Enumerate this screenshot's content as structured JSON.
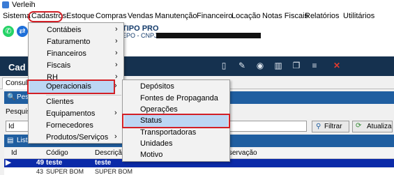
{
  "window": {
    "title": "Verleih"
  },
  "menubar": [
    "Sistema",
    "Cadastros",
    "Estoque",
    "Compras",
    "Vendas",
    "Manutenção",
    "Financeiro",
    "Locação",
    "Notas Fiscais",
    "Relatórios",
    "Utilitários"
  ],
  "company": {
    "name": "TIPO PRO",
    "cnpj_label": "EPO - CNPJ :"
  },
  "section_title": "Cad",
  "tabs": {
    "consulta": "Consulta"
  },
  "panels": {
    "pesquisa_bar": "Pesq",
    "pesquisa_label": "Pesquisa",
    "lista_bar": "Lista"
  },
  "search": {
    "field_label": "Id",
    "filter_button": "Filtrar",
    "refresh_button": "Atualiza"
  },
  "grid": {
    "headers": [
      "Id",
      "Código",
      "Descrição",
      "servação"
    ],
    "rows": [
      {
        "id": "49",
        "codigo": "teste",
        "descricao": "teste"
      },
      {
        "id": "43",
        "codigo": "SUPER BOM",
        "descricao": "SUPER BOM"
      }
    ]
  },
  "cadastros_menu": {
    "items": [
      "Contábeis",
      "Faturamento",
      "Financeiros",
      "Fiscais",
      "RH",
      "Operacionais",
      "Clientes",
      "Equipamentos",
      "Fornecedores",
      "Produtos/Serviços"
    ],
    "submenu_marker": "›"
  },
  "operacionais_menu": {
    "items": [
      "Depósitos",
      "Fontes de Propaganda",
      "Operações",
      "Status",
      "Transportadoras",
      "Unidades",
      "Motivo"
    ]
  },
  "colors": {
    "highlight_red": "#d21f26",
    "selection_blue": "#bcd6f3",
    "dark_header": "#15314f",
    "panel_blue": "#1f5ea0",
    "row_selected": "#0b2aa8"
  }
}
